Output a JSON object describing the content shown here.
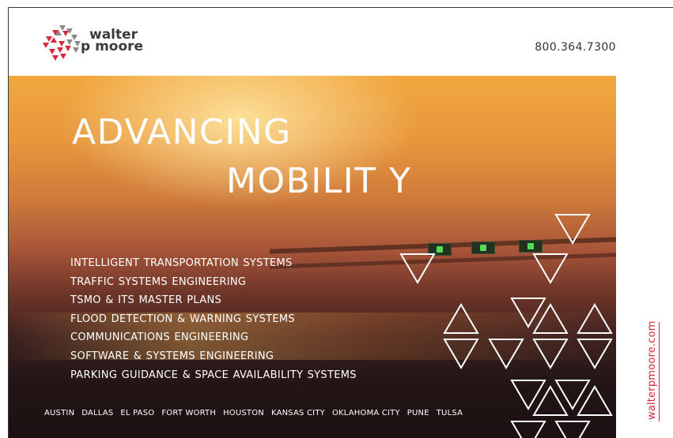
{
  "brand": {
    "line1": "walter",
    "line2": "p moore",
    "icon": "walter-p-moore-logo-icon",
    "colors": {
      "red": "#d6283f",
      "gray": "#8a8a8a",
      "dark": "#3b3b3b"
    }
  },
  "header": {
    "phone": "800.364.7300"
  },
  "hero": {
    "headline_line1": "ADVANCING",
    "headline_line2": "MOBILIT Y",
    "services": [
      "INTELLIGENT TRANSPORTATION SYSTEMS",
      "TRAFFIC SYSTEMS ENGINEERING",
      "TSMO & ITS MASTER PLANS",
      "FLOOD DETECTION & WARNING SYSTEMS",
      "COMMUNICATIONS ENGINEERING",
      "SOFTWARE  &  SYSTEMS  ENGINEERING",
      "PARKING  GUIDANCE  &  SPACE  AVAILABILITY  SYSTEMS"
    ],
    "cities": [
      "AUSTIN",
      "DALLAS",
      "EL PASO",
      "FORT WORTH",
      "HOUSTON",
      "KANSAS CITY",
      "OKLAHOMA CITY",
      "PUNE",
      "TULSA"
    ]
  },
  "side": {
    "url": "walterpmoore.com"
  }
}
